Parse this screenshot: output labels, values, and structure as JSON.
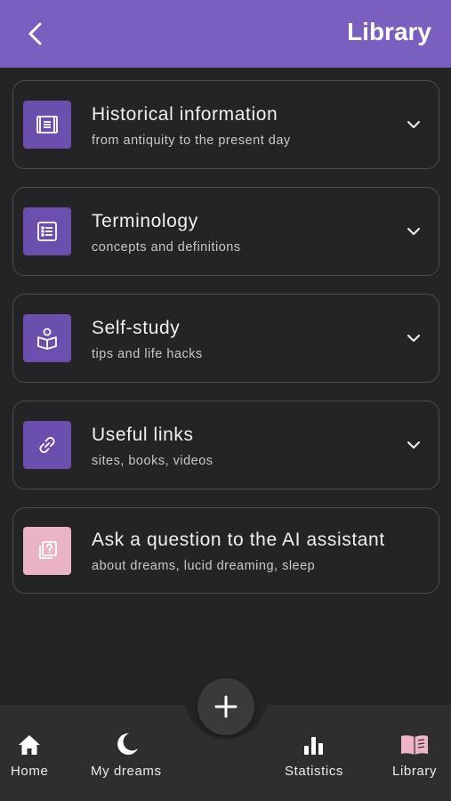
{
  "header": {
    "title": "Library",
    "back_icon": "chevron-left-icon",
    "background": "#7b5fc0"
  },
  "cards": [
    {
      "title": "Historical information",
      "subtitle": "from antiquity to the present day",
      "icon": "scroll-icon",
      "expandable": true
    },
    {
      "title": "Terminology",
      "subtitle": "concepts and definitions",
      "icon": "list-icon",
      "expandable": true
    },
    {
      "title": "Self-study",
      "subtitle": "tips and life hacks",
      "icon": "reader-icon",
      "expandable": true
    },
    {
      "title": "Useful links",
      "subtitle": "sites, books, videos",
      "icon": "link-icon",
      "expandable": true
    },
    {
      "title": "Ask a question to the AI assistant",
      "subtitle": "about dreams, lucid dreaming, sleep",
      "icon": "question-icon",
      "expandable": false
    }
  ],
  "nav": {
    "items": [
      {
        "label": "Home",
        "icon": "home-icon"
      },
      {
        "label": "My dreams",
        "icon": "moon-icon"
      },
      {
        "label": "Statistics",
        "icon": "bar-chart-icon"
      },
      {
        "label": "Library",
        "icon": "book-icon",
        "active": true
      }
    ],
    "fab_icon": "plus-icon"
  },
  "colors": {
    "accent": "#7b5fc0",
    "tile": "#6b4fae",
    "tile_pink": "#eab4c6",
    "active_nav": "#f0b4c8",
    "background": "#242326"
  }
}
